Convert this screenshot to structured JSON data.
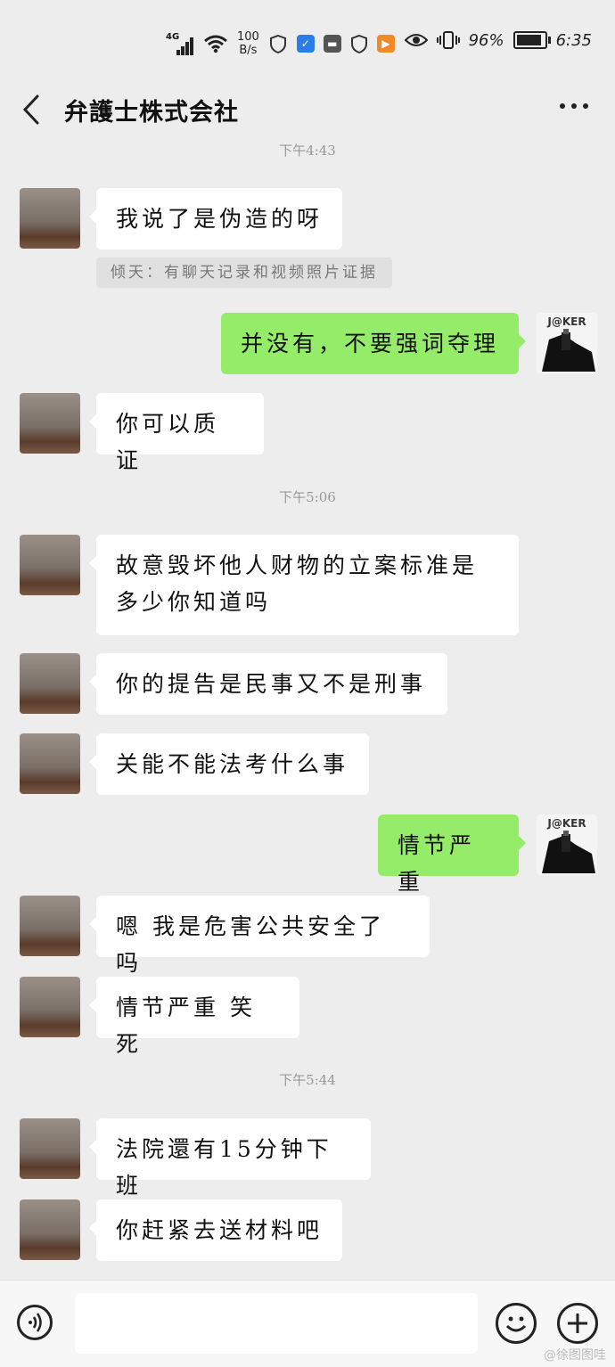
{
  "status_bar": {
    "network": "4G",
    "speed_value": "100",
    "speed_unit": "B/s",
    "battery": "96%",
    "time": "6:35"
  },
  "header": {
    "title": "弁護士株式会社"
  },
  "messages": [
    {
      "type": "timestamp",
      "text": "下午4:43"
    },
    {
      "type": "in",
      "text": "我说了是伪造的呀"
    },
    {
      "type": "quote",
      "text": "倾天：有聊天记录和视频照片证据"
    },
    {
      "type": "out",
      "text": "并没有，不要强词夺理"
    },
    {
      "type": "in",
      "text": "你可以质证"
    },
    {
      "type": "timestamp",
      "text": "下午5:06"
    },
    {
      "type": "in",
      "text": "故意毁坏他人财物的立案标准是多少你知道吗"
    },
    {
      "type": "in",
      "text": "你的提告是民事又不是刑事"
    },
    {
      "type": "in",
      "text": "关能不能法考什么事"
    },
    {
      "type": "out",
      "text": "情节严重"
    },
    {
      "type": "in",
      "text": "嗯 我是危害公共安全了吗"
    },
    {
      "type": "in",
      "text": "情节严重 笑死"
    },
    {
      "type": "timestamp",
      "text": "下午5:44"
    },
    {
      "type": "in",
      "text": "法院還有15分钟下班"
    },
    {
      "type": "in",
      "text": "你赶紧去送材料吧"
    }
  ],
  "avatar_self_label": "J@KER",
  "watermark": "@徐图图哇",
  "colors": {
    "background": "#ededed",
    "incoming_bubble": "#ffffff",
    "outgoing_bubble": "#95ec69",
    "timestamp": "#999999"
  },
  "icons": [
    "back-icon",
    "more-icon",
    "voice-icon",
    "emoji-icon",
    "plus-icon",
    "wifi-icon",
    "eye-icon",
    "vibrate-icon",
    "battery-icon"
  ]
}
